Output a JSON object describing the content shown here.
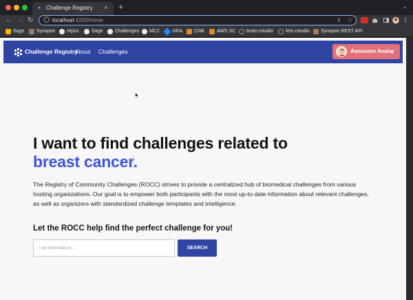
{
  "browser": {
    "tab": {
      "title": "Challenge Registry",
      "close_glyph": "×",
      "favicon": "chevron-icon"
    },
    "new_tab_glyph": "+",
    "menu_glyph": "⌄",
    "toolbar": {
      "back_glyph": "←",
      "forward_glyph": "→",
      "reload_glyph": "↻",
      "share_glyph": "⇪",
      "star_glyph": "☆"
    },
    "address": {
      "host": "localhost",
      "path": ":4200/home"
    },
    "window_colors": {
      "close": "#fe5f57",
      "minimize": "#febc2e",
      "maximize": "#28c840"
    },
    "bookmarks": [
      {
        "label": "Sage",
        "icon": "sage-icon",
        "color": "#f4b400"
      },
      {
        "label": "Synapse",
        "icon": "synapse-icon",
        "color": "#a47a5c"
      },
      {
        "label": "repos",
        "icon": "github-icon",
        "color": "#e8eaed"
      },
      {
        "label": "Sage",
        "icon": "github-icon",
        "color": "#e8eaed"
      },
      {
        "label": "Challenges",
        "icon": "github-icon",
        "color": "#e8eaed"
      },
      {
        "label": "MC2",
        "icon": "github-icon",
        "color": "#e8eaed"
      },
      {
        "label": "JIRA",
        "icon": "jira-icon",
        "color": "#2684ff"
      },
      {
        "label": "CNB",
        "icon": "aws-icon",
        "color": "#e08a2c"
      },
      {
        "label": "AWS SC",
        "icon": "aws-icon",
        "color": "#e08a2c"
      },
      {
        "label": "brats-rstudio",
        "icon": "globe-icon",
        "color": "#9aa0a6"
      },
      {
        "label": "fets-rstudio",
        "icon": "globe-icon",
        "color": "#9aa0a6"
      },
      {
        "label": "Synapse REST API",
        "icon": "synapse-icon",
        "color": "#a47a5c"
      }
    ]
  },
  "app": {
    "brand": "Challenge Registry",
    "nav": [
      {
        "label": "About"
      },
      {
        "label": "Challenges"
      }
    ],
    "user": {
      "name": "Awesome Avatar",
      "menu_glyph": "⌄"
    },
    "colors": {
      "navbar": "#3045a3",
      "accent": "#3d55d6",
      "user_button": "#e36f78"
    }
  },
  "hero": {
    "title": "I want to find challenges related to",
    "topic": "breast cancer.",
    "intro": "The Registry of Community Challenges (ROCC) strives to provide a centralized hub of biomedical challenges from various hosting organizations. Our goal is to empower both participants with the most up-to-date information about relevant challenges, as well as organizers with standardized challenge templates and intelligence.",
    "cta": "Let the ROCC help find the perfect challenge for you!"
  },
  "search": {
    "placeholder": "I am interested in...",
    "value": "",
    "button_label": "SEARCH"
  }
}
